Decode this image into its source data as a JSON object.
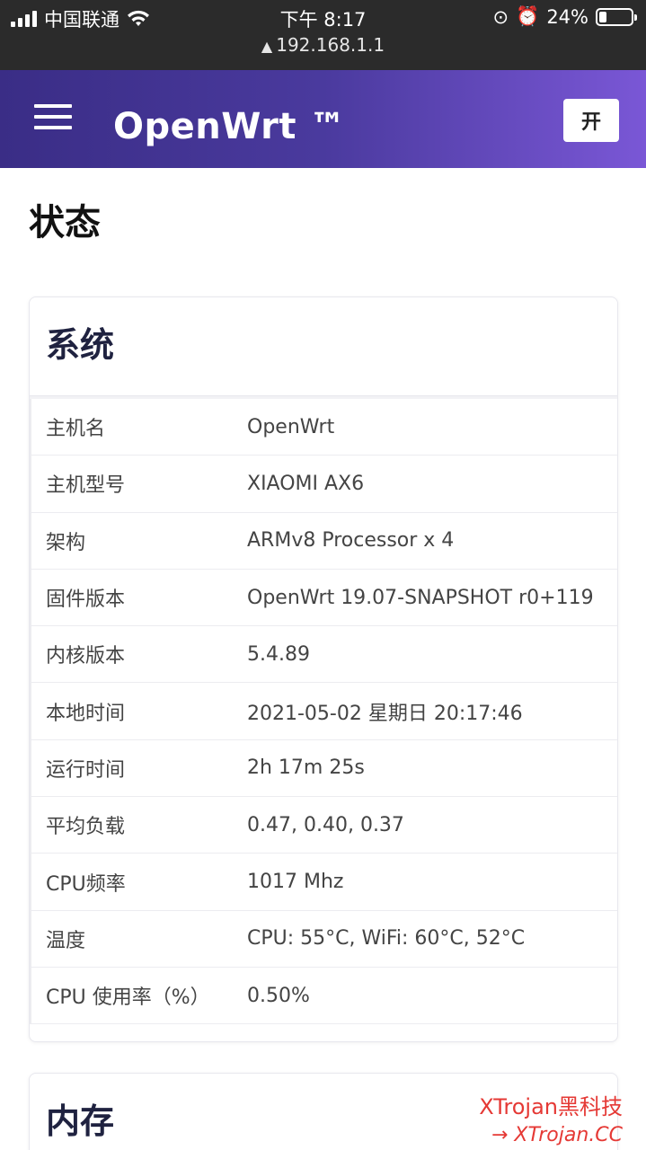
{
  "status_bar": {
    "carrier": "中国联通",
    "time": "下午 8:17",
    "url": "192.168.1.1",
    "battery": "24%",
    "battery_level": 0.24
  },
  "header": {
    "brand": "OpenWrt ™",
    "lang_button": "开"
  },
  "page": {
    "title": "状态"
  },
  "system": {
    "title": "系统",
    "rows": [
      {
        "label": "主机名",
        "value": "OpenWrt"
      },
      {
        "label": "主机型号",
        "value": "XIAOMI AX6"
      },
      {
        "label": "架构",
        "value": "ARMv8 Processor x 4"
      },
      {
        "label": "固件版本",
        "value": "OpenWrt 19.07-SNAPSHOT r0+119"
      },
      {
        "label": "内核版本",
        "value": "5.4.89"
      },
      {
        "label": "本地时间",
        "value": "2021-05-02 星期日 20:17:46"
      },
      {
        "label": "运行时间",
        "value": "2h 17m 25s"
      },
      {
        "label": "平均负载",
        "value": "0.47, 0.40, 0.37"
      },
      {
        "label": "CPU频率",
        "value": "1017 Mhz"
      },
      {
        "label": "温度",
        "value": "CPU: 55°C, WiFi: 60°C, 52°C"
      },
      {
        "label": "CPU 使用率（%）",
        "value": "0.50%"
      }
    ]
  },
  "memory": {
    "title": "内存"
  },
  "watermark": {
    "line1": "XTrojan黑科技",
    "line2": "→ XTrojan.CC"
  }
}
